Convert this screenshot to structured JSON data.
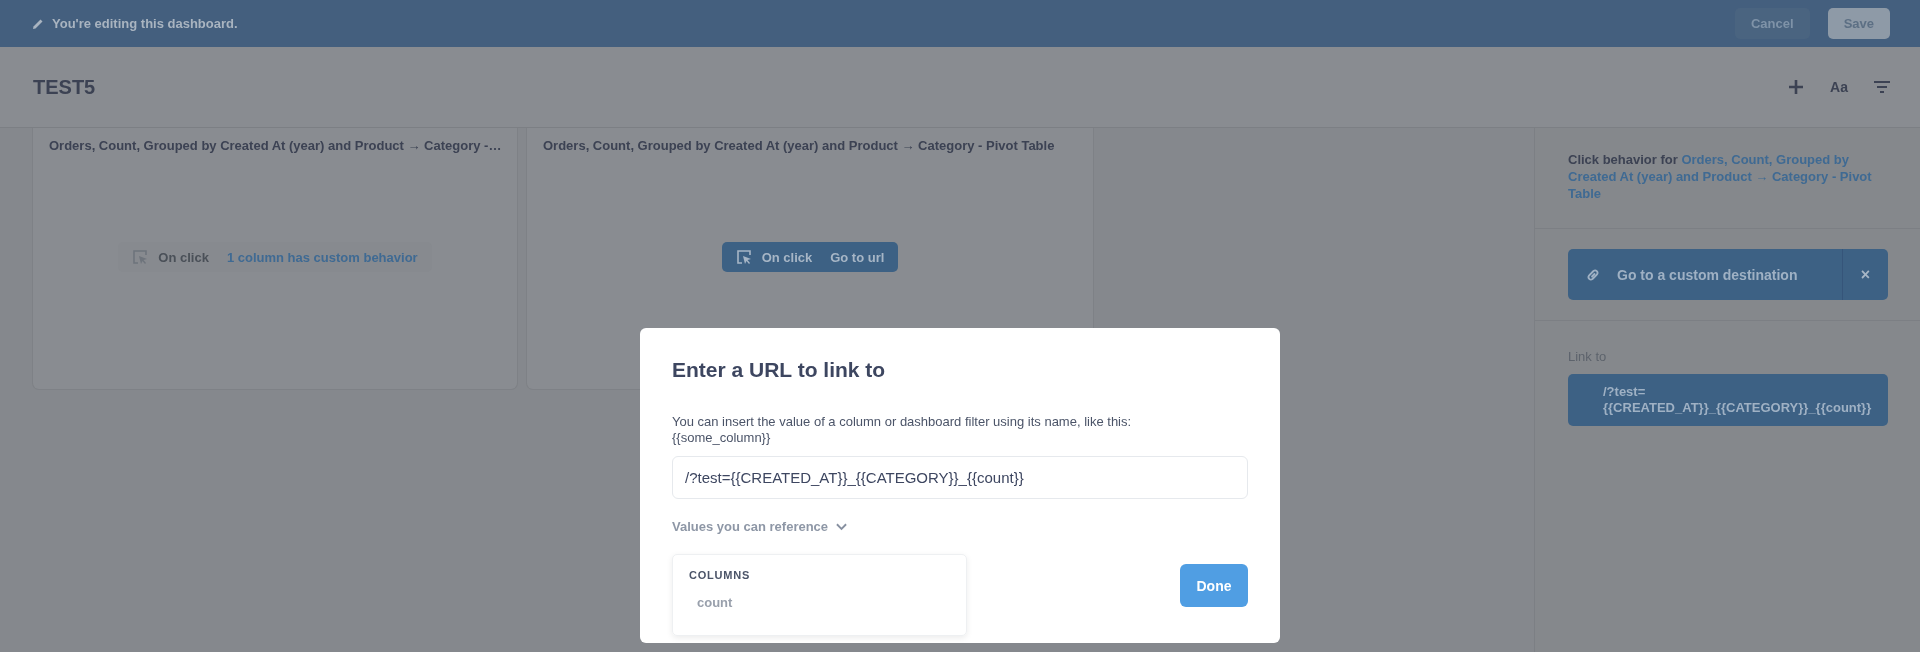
{
  "edit_bar": {
    "message": "You're editing this dashboard.",
    "buttons": [
      {
        "label": "Cancel",
        "kind": "cancel"
      },
      {
        "label": "Save",
        "kind": "save"
      }
    ]
  },
  "dashboard": {
    "title": "TEST5",
    "tools": [
      {
        "kind": "add"
      },
      {
        "kind": "text",
        "label": "Aa"
      },
      {
        "kind": "filter"
      }
    ]
  },
  "cards": [
    {
      "title": "Orders, Count, Grouped by Created At (year) and Product → Category -…",
      "on_click": {
        "label": "On click",
        "value": "1 column has custom behavior",
        "active": false
      }
    },
    {
      "title": "Orders, Count, Grouped by Created At (year) and Product → Category - Pivot Table",
      "on_click": {
        "label": "On click",
        "value": "Go to url",
        "active": true
      }
    }
  ],
  "sidebar": {
    "heading": "Click behavior for ",
    "heading_link": "Orders, Count, Grouped by Created At (year) and Product → Category - Pivot Table",
    "destination": {
      "label": "Go to a custom destination",
      "close": "×"
    },
    "link_to_label": "Link to",
    "link_lines": [
      "/?test=",
      "{{CREATED_AT}}_{{CATEGORY}}_{{count}}"
    ]
  },
  "modal": {
    "title": "Enter a URL to link to",
    "description": "You can insert the value of a column or dashboard filter using its name, like this:\n{{some_column}}",
    "url": "/?test={{CREATED_AT}}_{{CATEGORY}}_{{count}}",
    "values_toggle": {
      "label": "Values you can reference",
      "expanded": true
    },
    "popover": {
      "section": "COLUMNS",
      "items": [
        "count"
      ]
    },
    "done": "Done"
  }
}
